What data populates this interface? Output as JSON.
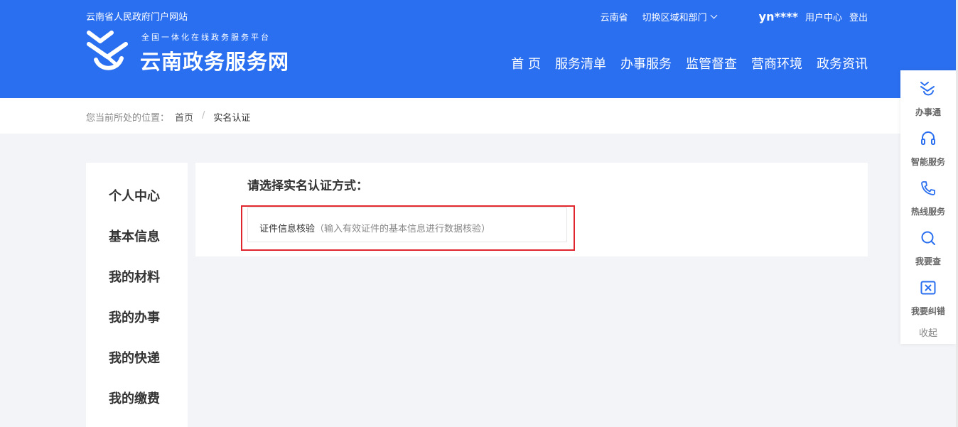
{
  "header": {
    "portal_link": "云南省人民政府门户网站",
    "logo_slogan": "全国一体化在线政务服务平台",
    "logo_title": "云南政务服务网",
    "region": "云南省",
    "switch_region": "切换区域和部门",
    "username": "yn****",
    "user_center": "用户中心",
    "logout": "登出",
    "nav": [
      "首 页",
      "服务清单",
      "办事服务",
      "监管督查",
      "营商环境",
      "政务资讯"
    ]
  },
  "breadcrumb": {
    "prefix": "您当前所处的位置：",
    "home": "首页",
    "separator": "/",
    "current": "实名认证"
  },
  "sidebar": {
    "items": [
      "个人中心",
      "基本信息",
      "我的材料",
      "我的办事",
      "我的快递",
      "我的缴费"
    ]
  },
  "main": {
    "title": "请选择实名认证方式：",
    "option_name": "证件信息核验",
    "option_desc": "（输入有效证件的基本信息进行数据核验）"
  },
  "float_bar": {
    "items": [
      {
        "label": "办事通",
        "icon": "logo-icon"
      },
      {
        "label": "智能服务",
        "icon": "headset-icon"
      },
      {
        "label": "热线服务",
        "icon": "phone-icon"
      },
      {
        "label": "我要查",
        "icon": "search-icon"
      },
      {
        "label": "我要纠错",
        "icon": "close-box-icon"
      }
    ],
    "collapse": "收起"
  },
  "colors": {
    "brand_blue": "#2a6ff0",
    "highlight_red": "#e0262c"
  }
}
